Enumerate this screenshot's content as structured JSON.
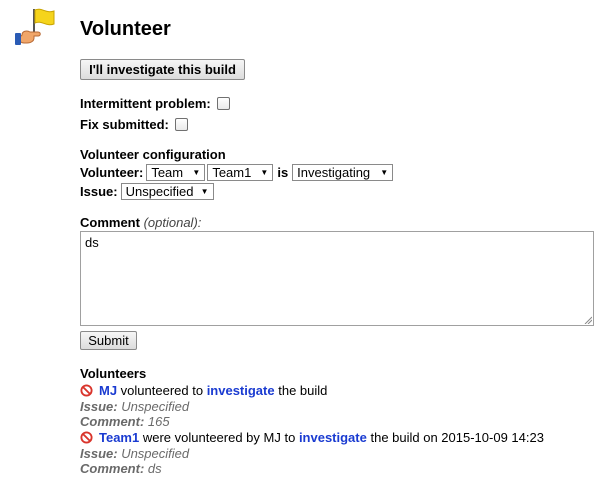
{
  "title": "Volunteer",
  "investigate_button": "I'll investigate this build",
  "intermittent_label": "Intermittent problem:",
  "fix_label": "Fix submitted:",
  "config": {
    "title": "Volunteer configuration",
    "volunteer_label": "Volunteer:",
    "volunteer_type": "Team",
    "volunteer_name": "Team1",
    "is_label": "is",
    "status": "Investigating",
    "issue_label": "Issue:",
    "issue": "Unspecified"
  },
  "comment": {
    "label": "Comment",
    "optional": "(optional):",
    "value": "ds"
  },
  "submit_label": "Submit",
  "volunteers": {
    "title": "Volunteers",
    "entries": [
      {
        "name": "MJ",
        "text1": " volunteered to ",
        "link": "investigate",
        "text2": " the build",
        "issue_key": "Issue:",
        "issue_value": " Unspecified",
        "comment_key": "Comment:",
        "comment_value": " 165"
      },
      {
        "name": "Team1",
        "text1": " were volunteered by MJ to ",
        "link": "investigate",
        "text2": " the build on 2015-10-09 14:23",
        "issue_key": "Issue:",
        "issue_value": " Unspecified",
        "comment_key": "Comment:",
        "comment_value": " ds"
      }
    ]
  },
  "icons": {
    "logo": "hand-flag-icon",
    "entry": "prohibited-icon"
  }
}
